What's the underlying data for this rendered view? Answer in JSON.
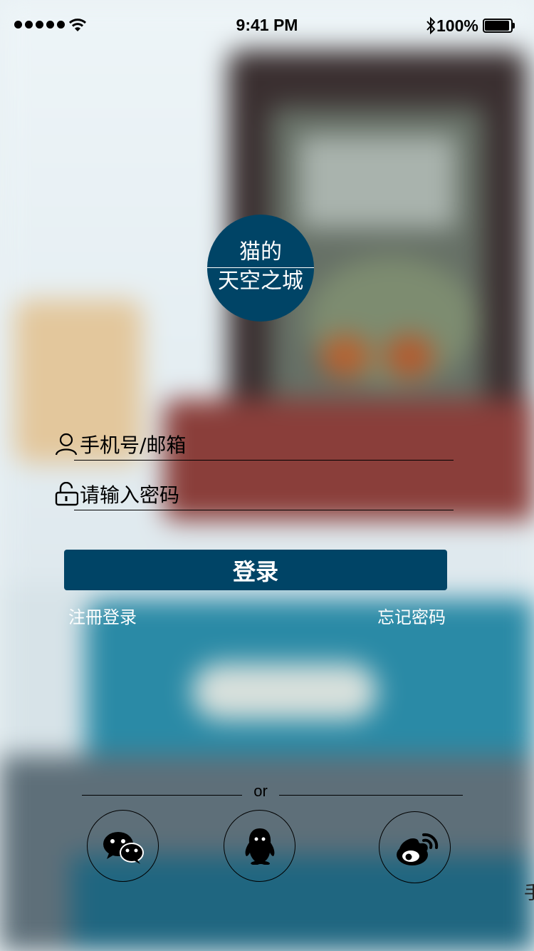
{
  "status_bar": {
    "time": "9:41 PM",
    "battery": "100%"
  },
  "logo": {
    "line1": "猫的",
    "line2": "天空之城"
  },
  "form": {
    "username_placeholder": "手机号/邮箱",
    "password_placeholder": "请输入密码",
    "login_button": "登录",
    "register_link": "注冊登录",
    "forgot_link": "忘记密码"
  },
  "divider": {
    "text": "or"
  },
  "social": [
    {
      "icon": "wechat-icon"
    },
    {
      "icon": "qq-icon"
    },
    {
      "icon": "weibo-icon"
    }
  ],
  "edge_text": "手",
  "colors": {
    "brand": "#004466"
  }
}
